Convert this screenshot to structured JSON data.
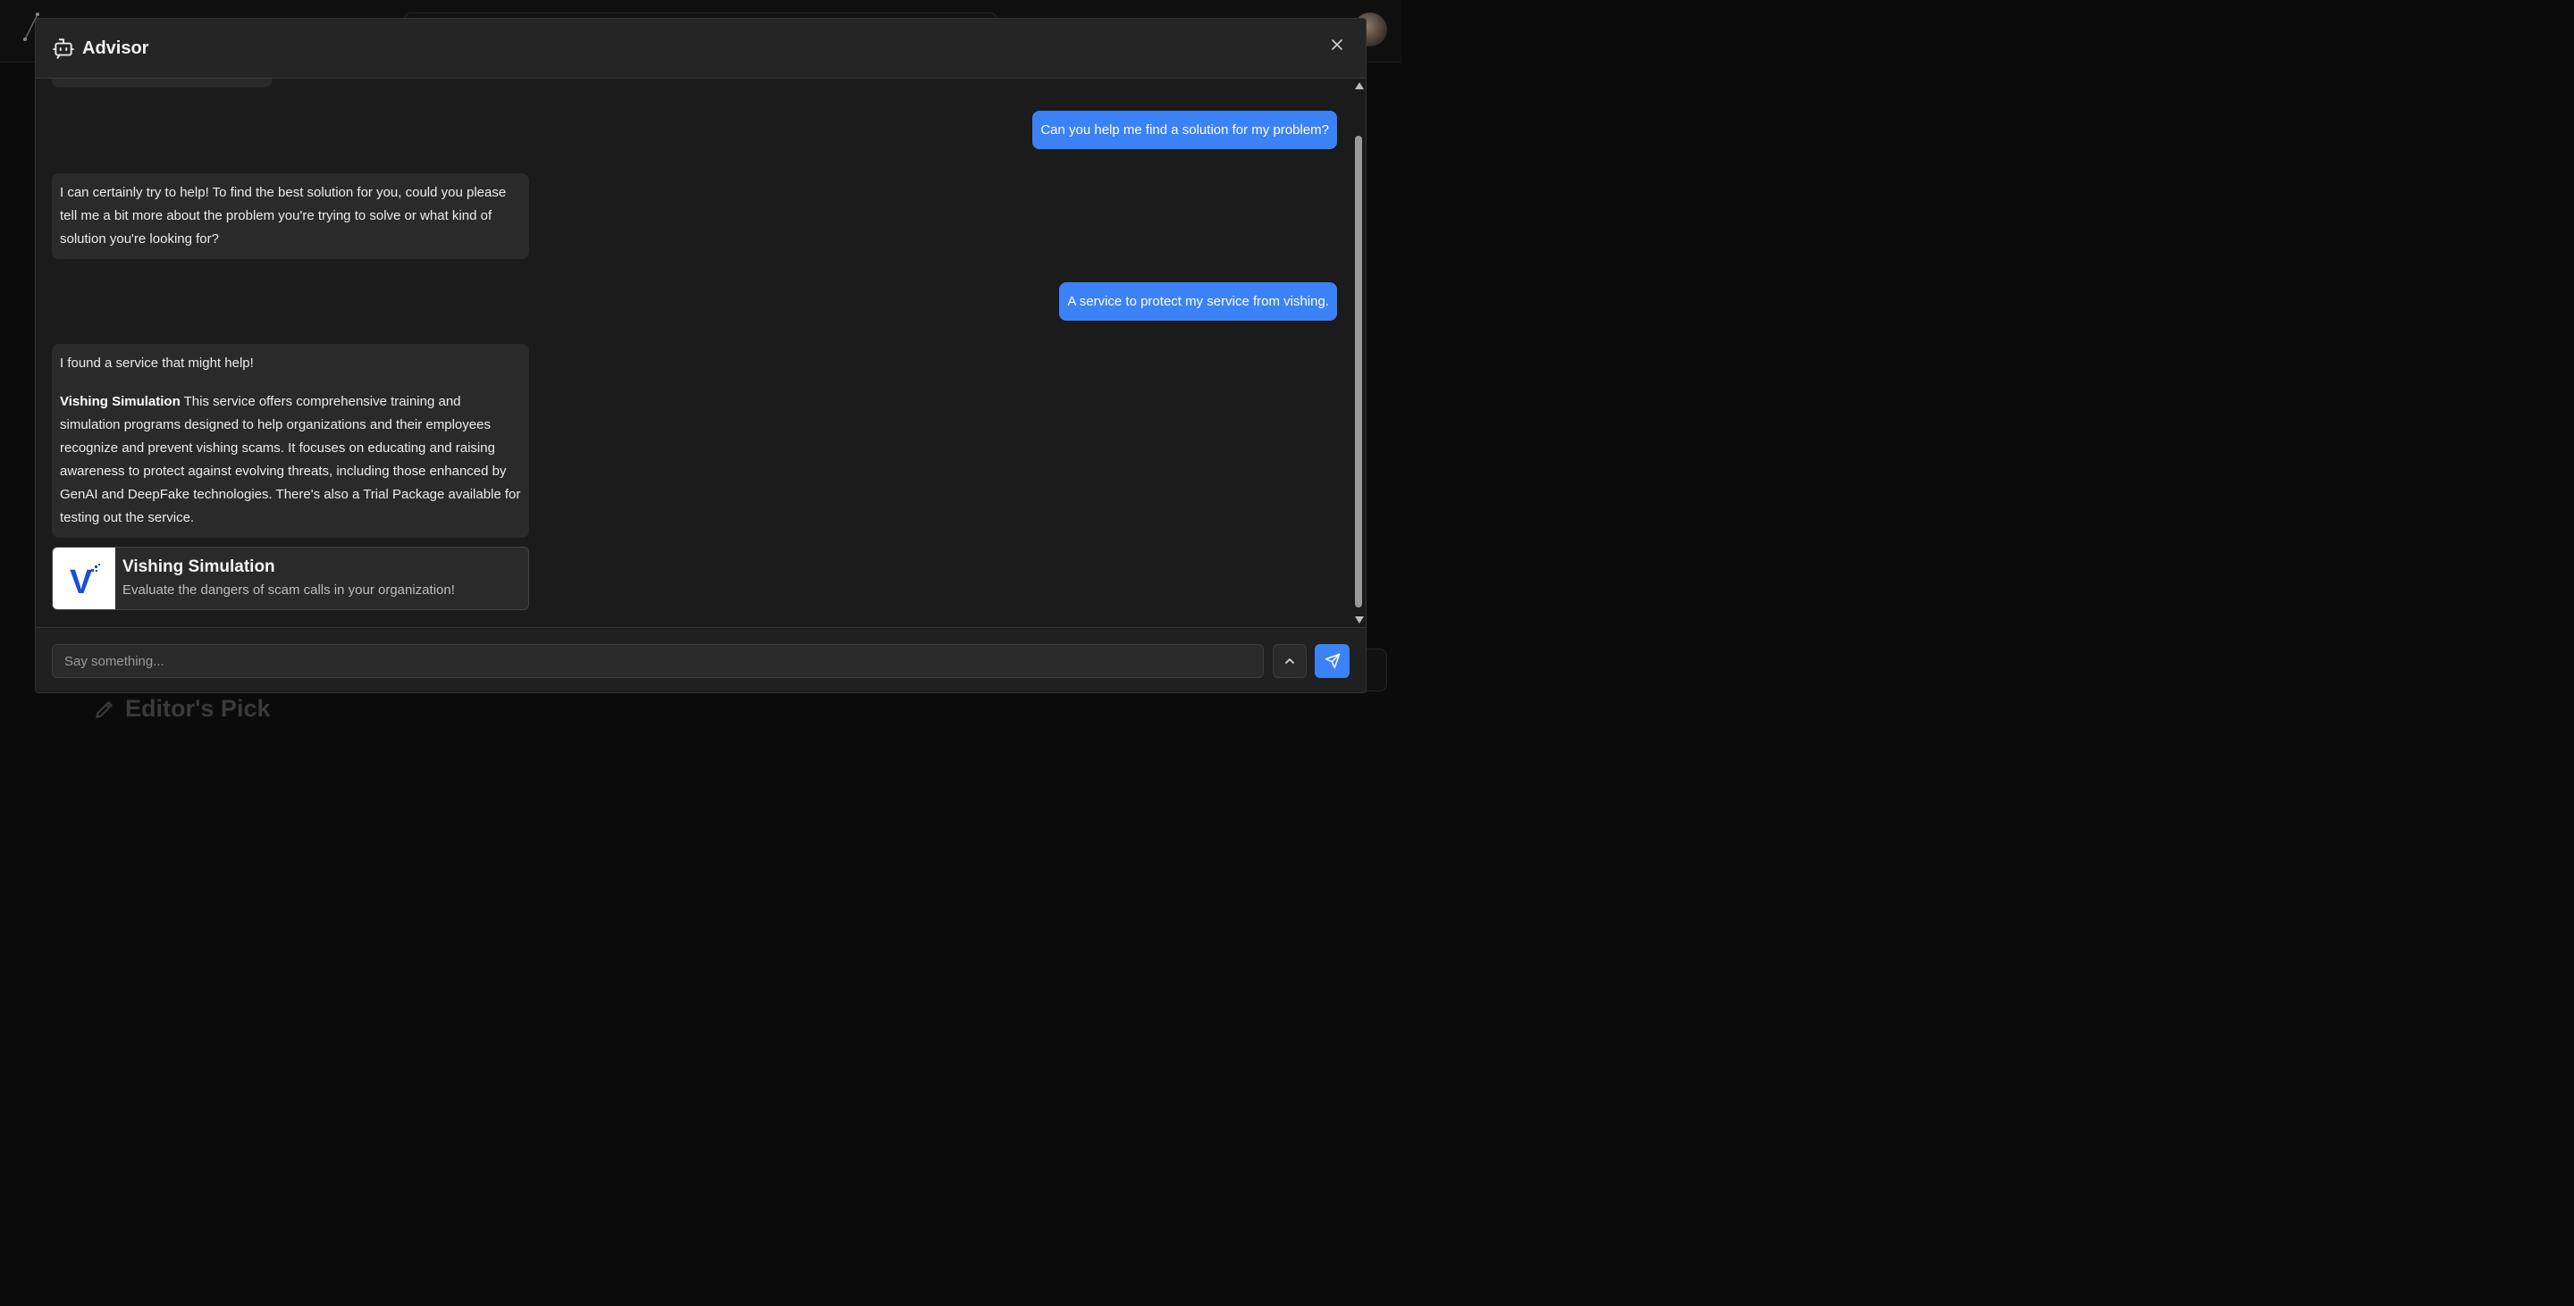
{
  "background": {
    "section_heading": "Editor's Pick"
  },
  "advisor": {
    "title": "Advisor",
    "icon": "bot-icon",
    "close_icon": "close-icon",
    "messages": [
      {
        "role": "user",
        "text": "Can you help me find a solution for my problem?"
      },
      {
        "role": "assistant",
        "text": "I can certainly try to help! To find the best solution for you, could you please tell me a bit more about the problem you're trying to solve or what kind of solution you're looking for?"
      },
      {
        "role": "user",
        "text": "A service to protect my service from vishing."
      },
      {
        "role": "assistant",
        "intro": "I found a service that might help!",
        "service_name": "Vishing Simulation",
        "description": " This service offers comprehensive training and simulation programs designed to help organizations and their employees recognize and prevent vishing scams. It focuses on educating and raising awareness to protect against evolving threats, including those enhanced by GenAI and DeepFake technologies. There's also a Trial Package available for testing out the service."
      }
    ],
    "service_card": {
      "title": "Vishing Simulation",
      "subtitle": "Evaluate the dangers of scam calls in your organization!",
      "logo_letter": "V",
      "logo_color": "#1d4ed8"
    },
    "input": {
      "placeholder": "Say something...",
      "value": ""
    },
    "expand_icon": "chevron-up-icon",
    "send_icon": "send-icon",
    "accent": "#3b82f6"
  }
}
